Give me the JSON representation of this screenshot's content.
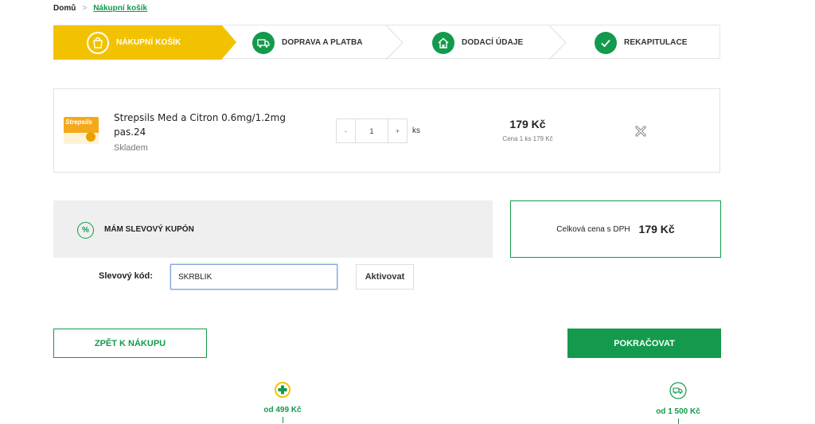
{
  "breadcrumb": {
    "home": "Domů",
    "separator": ">",
    "current": "Nákupní košík"
  },
  "steps": [
    {
      "label": "NÁKUPNÍ KOŠÍK",
      "icon": "shopping-bag-icon",
      "active": true
    },
    {
      "label": "DOPRAVA A PLATBA",
      "icon": "truck-icon",
      "active": false
    },
    {
      "label": "DODACÍ ÚDAJE",
      "icon": "house-icon",
      "active": false
    },
    {
      "label": "REKAPITULACE",
      "icon": "check-icon",
      "active": false
    }
  ],
  "cart": {
    "item": {
      "brand": "Strepsils",
      "name": "Strepsils Med a Citron 0.6mg/1.2mg pas.24",
      "stock": "Skladem",
      "qty_minus": "-",
      "qty_plus": "+",
      "quantity": "1",
      "unit": "ks",
      "price": "179 Kč",
      "unit_price": "Cena 1 ks 179 Kč"
    }
  },
  "coupon": {
    "icon_symbol": "%",
    "title": "MÁM SLEVOVÝ KUPÓN",
    "code_label": "Slevový kód:",
    "code_value": "SKRBLÍK",
    "activate_label": "Aktivovat"
  },
  "total": {
    "label": "Celková cena s DPH",
    "value": "179 Kč"
  },
  "actions": {
    "back": "ZPĚT K NÁKUPU",
    "continue": "POKRAČOVAT"
  },
  "benefits": [
    {
      "text": "od 499 Kč",
      "icon": "pharmacy-cross-icon"
    },
    {
      "text": "od 1 500 Kč",
      "icon": "delivery-truck-icon"
    }
  ],
  "colors": {
    "brand_green": "#139a4c",
    "accent_yellow": "#f2c200"
  }
}
